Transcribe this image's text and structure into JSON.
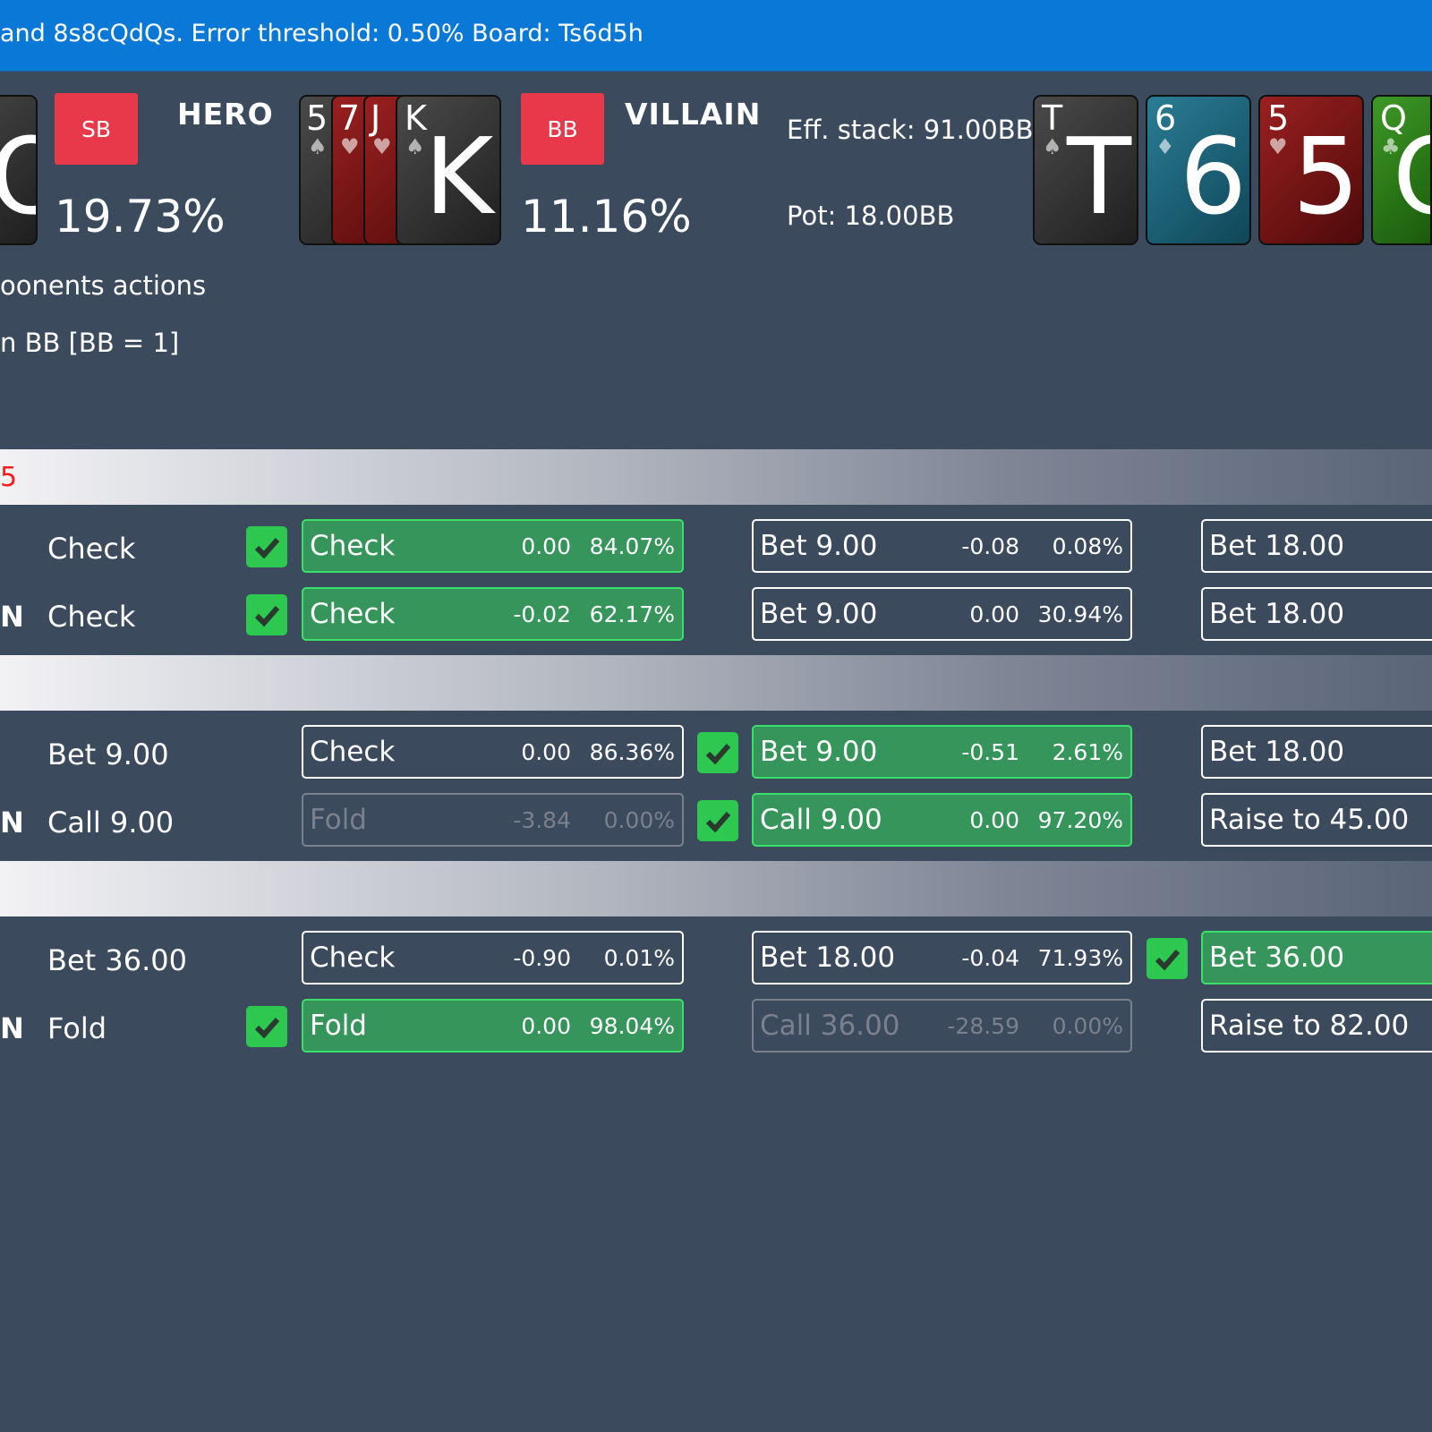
{
  "title_bar": {
    "text": "and 8s8cQdQs. Error threshold: 0.50% Board: Ts6d5h"
  },
  "hero": {
    "position_badge": "SB",
    "name": "HERO",
    "equity": "19.73%"
  },
  "villain": {
    "position_badge": "BB",
    "name": "VILLAIN",
    "equity": "11.16%",
    "cards": [
      {
        "rank": "5",
        "suit": "♠",
        "color": "black"
      },
      {
        "rank": "7",
        "suit": "♥",
        "color": "red"
      },
      {
        "rank": "J",
        "suit": "♥",
        "color": "red"
      },
      {
        "rank": "K",
        "suit": "♠",
        "color": "black"
      }
    ]
  },
  "stacks": {
    "eff_stack": "Eff. stack: 91.00BB",
    "pot": "Pot: 18.00BB"
  },
  "board": [
    {
      "rank": "T",
      "suit": "♠",
      "color": "black"
    },
    {
      "rank": "6",
      "suit": "♦",
      "color": "blue"
    },
    {
      "rank": "5",
      "suit": "♥",
      "color": "red"
    },
    {
      "rank": "Q",
      "suit": "♣",
      "color": "green"
    }
  ],
  "notes": {
    "line1": "oonents actions",
    "line2": "n BB [BB = 1]"
  },
  "sections": [
    {
      "header": "5",
      "rows": [
        {
          "prefix": "",
          "action": "Check",
          "options": [
            {
              "label": "Check",
              "ev": "0.00",
              "pct": "84.07%",
              "state": "selected",
              "checked": true
            },
            {
              "label": "Bet 9.00",
              "ev": "-0.08",
              "pct": "0.08%",
              "state": "normal",
              "checked": false
            },
            {
              "label": "Bet 18.00",
              "ev": "",
              "pct": "",
              "state": "normal",
              "checked": false
            }
          ]
        },
        {
          "prefix": "N",
          "action": "Check",
          "options": [
            {
              "label": "Check",
              "ev": "-0.02",
              "pct": "62.17%",
              "state": "selected",
              "checked": true
            },
            {
              "label": "Bet 9.00",
              "ev": "0.00",
              "pct": "30.94%",
              "state": "normal",
              "checked": false
            },
            {
              "label": "Bet 18.00",
              "ev": "",
              "pct": "",
              "state": "normal",
              "checked": false
            }
          ]
        }
      ]
    },
    {
      "header": "",
      "rows": [
        {
          "prefix": "",
          "action": "Bet 9.00",
          "options": [
            {
              "label": "Check",
              "ev": "0.00",
              "pct": "86.36%",
              "state": "normal",
              "checked": false
            },
            {
              "label": "Bet 9.00",
              "ev": "-0.51",
              "pct": "2.61%",
              "state": "selected",
              "checked": true
            },
            {
              "label": "Bet 18.00",
              "ev": "",
              "pct": "",
              "state": "normal",
              "checked": false
            }
          ]
        },
        {
          "prefix": "N",
          "action": "Call 9.00",
          "options": [
            {
              "label": "Fold",
              "ev": "-3.84",
              "pct": "0.00%",
              "state": "disabled",
              "checked": false
            },
            {
              "label": "Call 9.00",
              "ev": "0.00",
              "pct": "97.20%",
              "state": "selected",
              "checked": true
            },
            {
              "label": "Raise to 45.00",
              "ev": "",
              "pct": "",
              "state": "normal",
              "checked": false
            }
          ]
        }
      ]
    },
    {
      "header": "",
      "rows": [
        {
          "prefix": "",
          "action": "Bet 36.00",
          "options": [
            {
              "label": "Check",
              "ev": "-0.90",
              "pct": "0.01%",
              "state": "normal",
              "checked": false
            },
            {
              "label": "Bet 18.00",
              "ev": "-0.04",
              "pct": "71.93%",
              "state": "normal",
              "checked": false
            },
            {
              "label": "Bet 36.00",
              "ev": "",
              "pct": "",
              "state": "selected",
              "checked": true
            }
          ]
        },
        {
          "prefix": "N",
          "action": "Fold",
          "options": [
            {
              "label": "Fold",
              "ev": "0.00",
              "pct": "98.04%",
              "state": "selected",
              "checked": true
            },
            {
              "label": "Call 36.00",
              "ev": "-28.59",
              "pct": "0.00%",
              "state": "disabled",
              "checked": false
            },
            {
              "label": "Raise to 82.00",
              "ev": "",
              "pct": "",
              "state": "normal",
              "checked": false
            }
          ]
        }
      ]
    }
  ],
  "colors": {
    "background": "#3c4a5e",
    "title_bar": "#0a78d7",
    "badge": "#e8394a",
    "selected": "#35955a",
    "check": "#2cc84f",
    "header_text": "#ff1a1a"
  }
}
